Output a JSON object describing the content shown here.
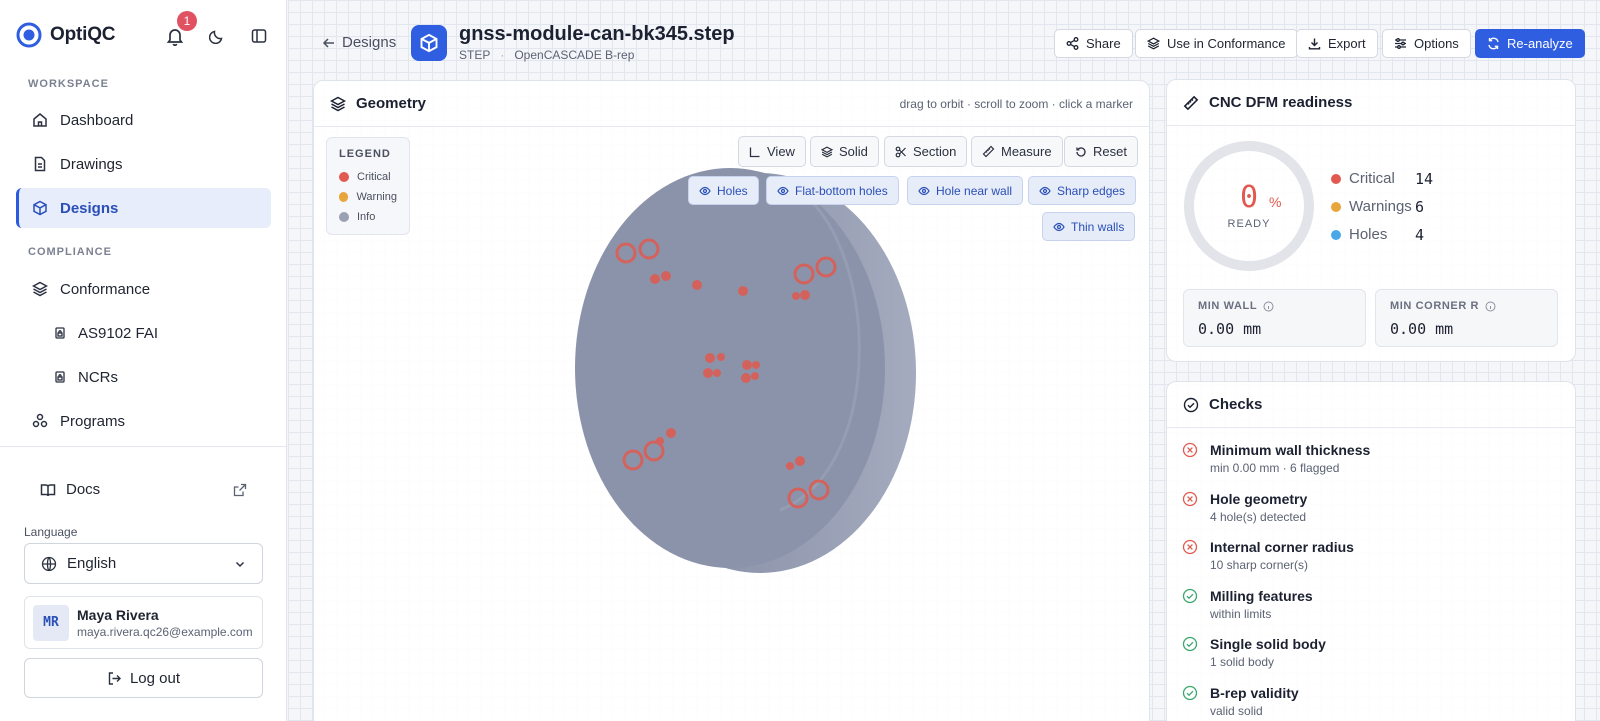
{
  "brand": {
    "name": "OptiQC"
  },
  "notifications": {
    "count": "1"
  },
  "sidebar": {
    "workspace_label": "WORKSPACE",
    "compliance_label": "COMPLIANCE",
    "items": {
      "dashboard": "Dashboard",
      "drawings": "Drawings",
      "designs": "Designs",
      "conformance": "Conformance",
      "as9102": "AS9102 FAI",
      "ncrs": "NCRs",
      "programs": "Programs"
    },
    "docs": "Docs",
    "language_label": "Language",
    "language_value": "English",
    "user": {
      "initials": "MR",
      "name": "Maya Rivera",
      "email": "maya.rivera.qc26@example.com"
    },
    "logout": "Log out"
  },
  "header": {
    "back": "Designs",
    "title": "gnss-module-can-bk345.step",
    "format": "STEP",
    "kernel": "OpenCASCADE B-rep",
    "actions": {
      "share": "Share",
      "use_in_conformance": "Use in Conformance",
      "export": "Export",
      "options": "Options",
      "reanalyze": "Re-analyze"
    }
  },
  "geometry": {
    "title": "Geometry",
    "hint": "drag to orbit · scroll to zoom · click a marker",
    "legend": {
      "title": "LEGEND",
      "critical": "Critical",
      "warning": "Warning",
      "info": "Info"
    },
    "view_buttons": {
      "view": "View",
      "solid": "Solid",
      "section": "Section",
      "measure": "Measure",
      "reset": "Reset"
    },
    "filters": {
      "holes": "Holes",
      "flat_bottom": "Flat-bottom holes",
      "hole_near_wall": "Hole near wall",
      "sharp_edges": "Sharp edges",
      "thin_walls": "Thin walls"
    }
  },
  "dfm": {
    "title": "CNC DFM readiness",
    "score": "0",
    "score_unit": "%",
    "score_label": "READY",
    "score_fraction": 0,
    "legend": [
      {
        "label": "Critical",
        "value": "14",
        "color": "#e05a4f"
      },
      {
        "label": "Warnings",
        "value": "6",
        "color": "#e8a53a"
      },
      {
        "label": "Holes",
        "value": "4",
        "color": "#4aa8e8"
      }
    ],
    "min_wall": {
      "label": "MIN WALL",
      "value": "0.00  mm"
    },
    "min_corner": {
      "label": "MIN CORNER R",
      "value": "0.00  mm"
    }
  },
  "checks": {
    "title": "Checks",
    "items": [
      {
        "title": "Minimum wall thickness",
        "sub": "min 0.00 mm · 6 flagged",
        "status": "fail"
      },
      {
        "title": "Hole geometry",
        "sub": "4 hole(s) detected",
        "status": "fail"
      },
      {
        "title": "Internal corner radius",
        "sub": "10 sharp corner(s)",
        "status": "fail"
      },
      {
        "title": "Milling features",
        "sub": "within limits",
        "status": "pass"
      },
      {
        "title": "Single solid body",
        "sub": "1 solid body",
        "status": "pass"
      },
      {
        "title": "B-rep validity",
        "sub": "valid solid",
        "status": "pass"
      }
    ]
  },
  "colors": {
    "accent": "#2f5fe0",
    "critical": "#e05a4f",
    "warning": "#e8a53a",
    "pass": "#3aa76d",
    "model": "#8b93aa"
  }
}
